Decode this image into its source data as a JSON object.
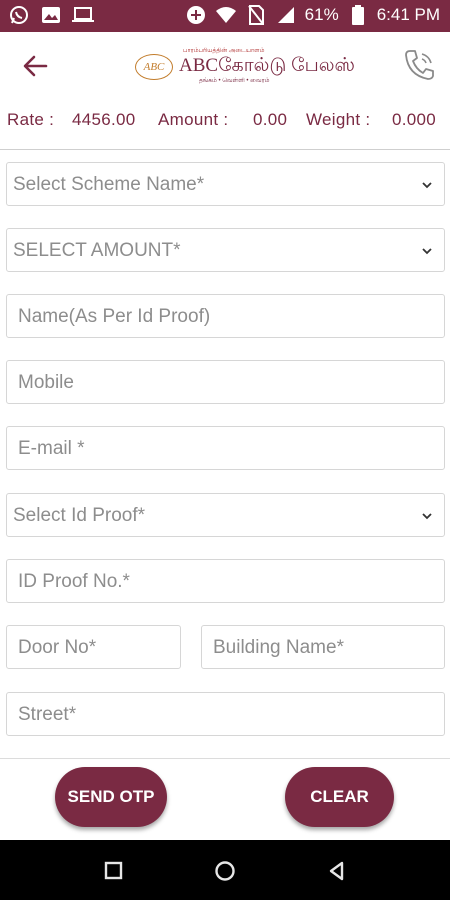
{
  "status_bar": {
    "battery": "61%",
    "time": "6:41 PM",
    "left_icons": [
      "whatsapp-icon",
      "image-icon",
      "laptop-icon"
    ],
    "right_icons": [
      "data-saver-icon",
      "wifi-icon",
      "no-sim-icon",
      "signal-icon",
      "battery-icon"
    ]
  },
  "header": {
    "logo_monogram": "ABC",
    "logo_top_text": "பாரம்பரியத்தின் அடையாளம்",
    "logo_main_text": "ABCகோல்டு பேலஸ்",
    "logo_sub_text": "தங்கம் • வெள்ளி • வைரம்"
  },
  "rate_row": {
    "rate_label": "Rate :",
    "rate_value": "4456.00",
    "amount_label": "Amount :",
    "amount_value": "0.00",
    "weight_label": "Weight :",
    "weight_value": "0.000"
  },
  "form": {
    "scheme_select": "Select Scheme Name*",
    "amount_select": "SELECT AMOUNT*",
    "name_placeholder": "Name(As Per Id Proof)",
    "mobile_placeholder": "Mobile",
    "email_placeholder": "E-mail *",
    "id_proof_select": "Select Id Proof*",
    "id_proof_no_placeholder": "ID Proof No.*",
    "door_no_placeholder": "Door No*",
    "building_name_placeholder": "Building Name*",
    "street_placeholder": "Street*"
  },
  "buttons": {
    "send_otp": "SEND OTP",
    "clear": "CLEAR"
  },
  "colors": {
    "brand": "#7a2a43",
    "gold": "#c27c2b",
    "placeholder": "#8d8d8d",
    "border": "#d6d6d6"
  }
}
